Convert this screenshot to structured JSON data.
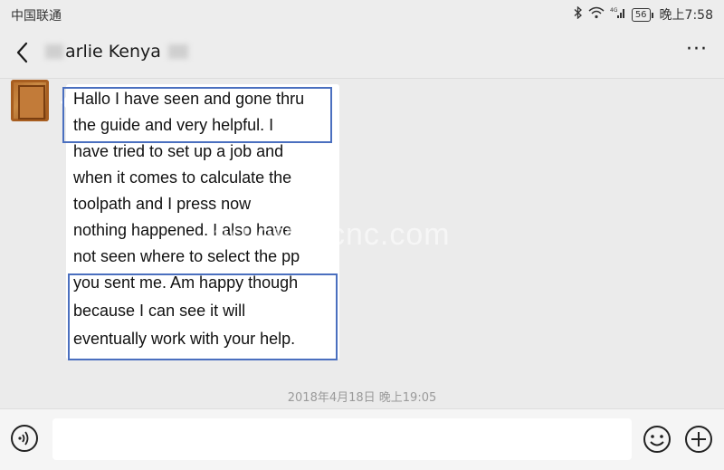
{
  "status_bar": {
    "carrier": "中国联通",
    "signal_text": "56",
    "time": "晚上7:58"
  },
  "header": {
    "title": "arlie Kenya",
    "back_icon": "chevron-left-icon",
    "more_label": "···"
  },
  "message": {
    "lines": [
      "Hallo I have seen and gone thru",
      "the guide and very helpful. I",
      "have tried to set up a job and",
      "when it comes to calculate the",
      "toolpath and I press now",
      "nothing happened. I also have",
      "not seen where to select the pp",
      "you sent me. Am happy though",
      "because I can see it will",
      "eventually work with your help."
    ],
    "highlight_color": "#4a6fbf"
  },
  "watermark": "agletec-cnc.com",
  "timestamp": "2018年4月18日 晚上19:05",
  "input_bar": {
    "voice_icon": "voice-icon",
    "emoji_icon": "emoji-icon",
    "plus_icon": "plus-icon",
    "value": ""
  }
}
